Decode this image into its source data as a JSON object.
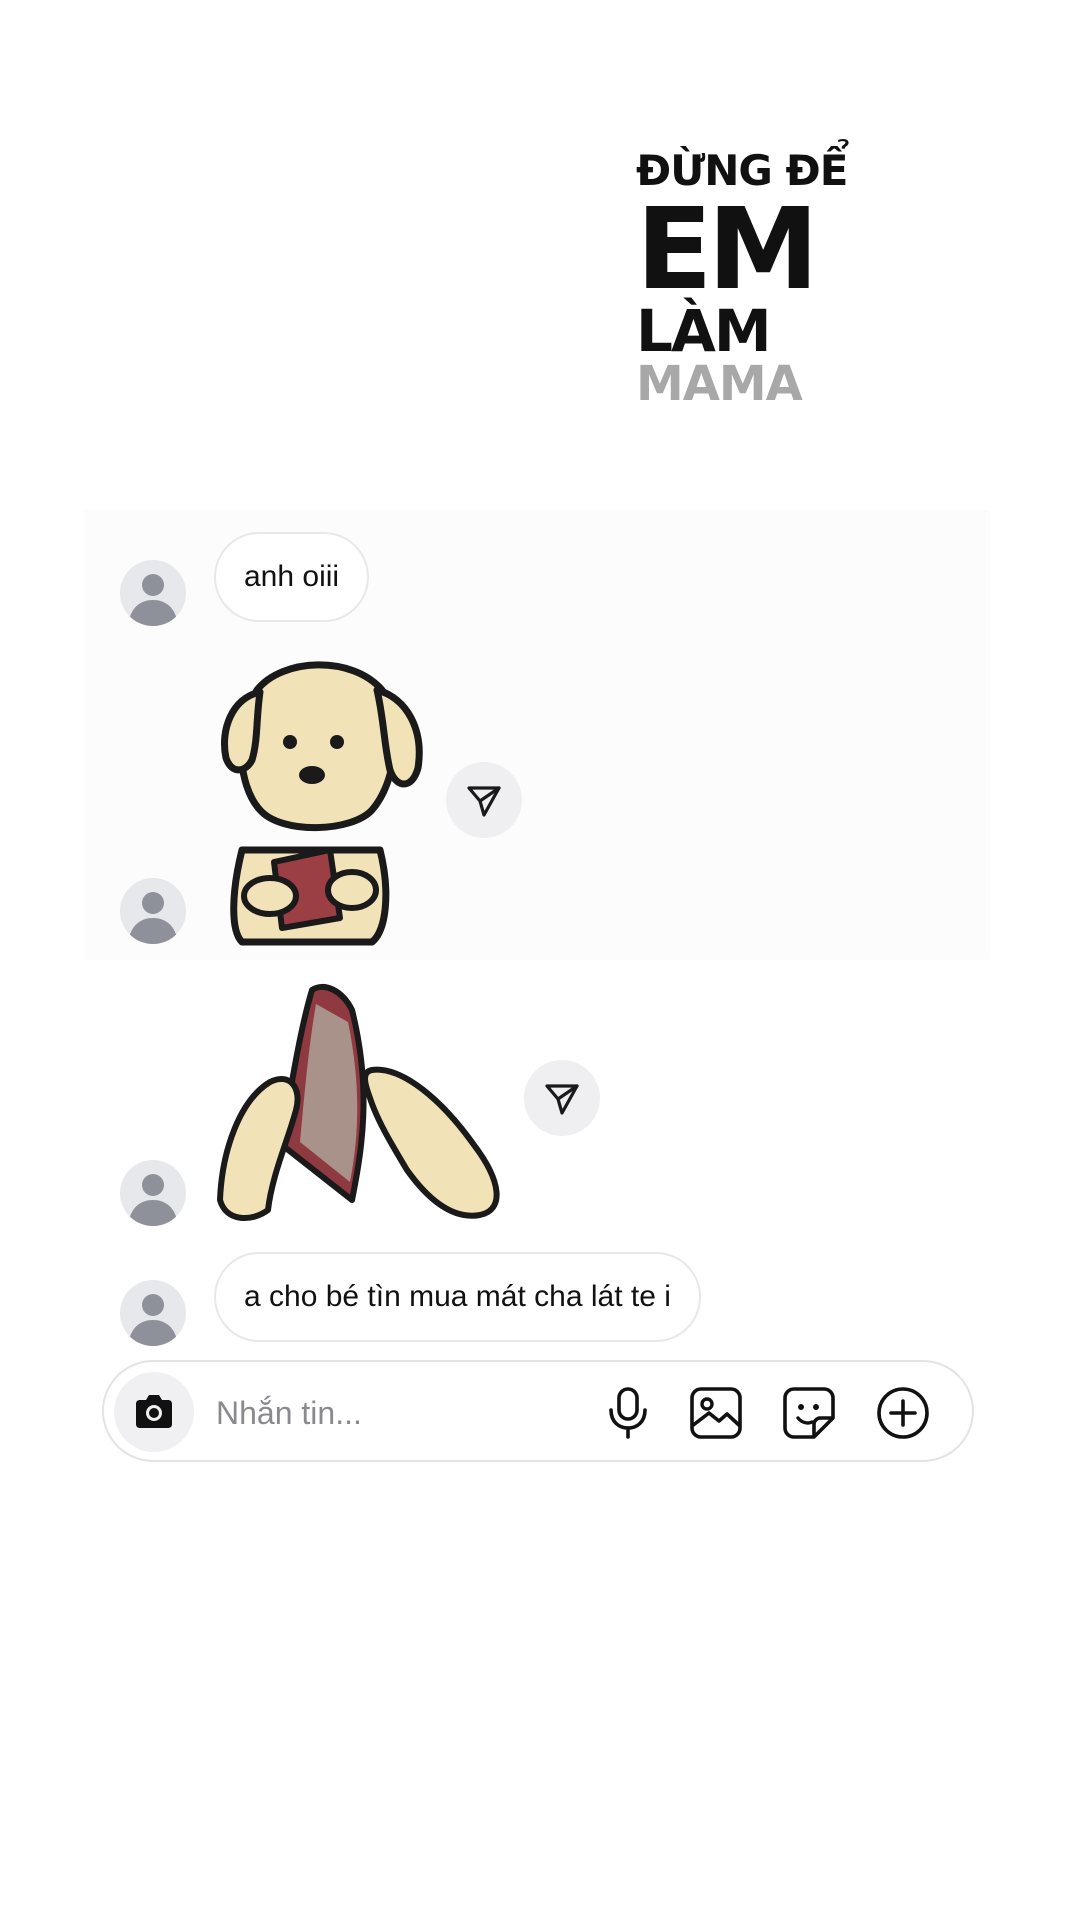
{
  "title": {
    "line1": "ĐỪNG ĐỂ",
    "line2": "EM",
    "line3": "LÀM",
    "line4": "MAMA"
  },
  "messages": [
    {
      "type": "text",
      "text": "anh oiii"
    },
    {
      "type": "sticker",
      "sticker": "puppy-holding-wallet"
    },
    {
      "type": "sticker",
      "sticker": "hands-holding-empty-wallet"
    },
    {
      "type": "text",
      "text": "a cho bé tìn mua mát cha lát te i"
    }
  ],
  "composer": {
    "placeholder": "Nhắn tin...",
    "icons": [
      "camera-icon",
      "microphone-icon",
      "image-icon",
      "sticker-icon",
      "plus-circle-icon"
    ]
  },
  "colors": {
    "background": "#ffffff",
    "bubble_border": "#e8e8ea",
    "avatar_bg": "#e7e8ec",
    "avatar_fg": "#8e909a",
    "title_muted": "#a8a8a8"
  }
}
